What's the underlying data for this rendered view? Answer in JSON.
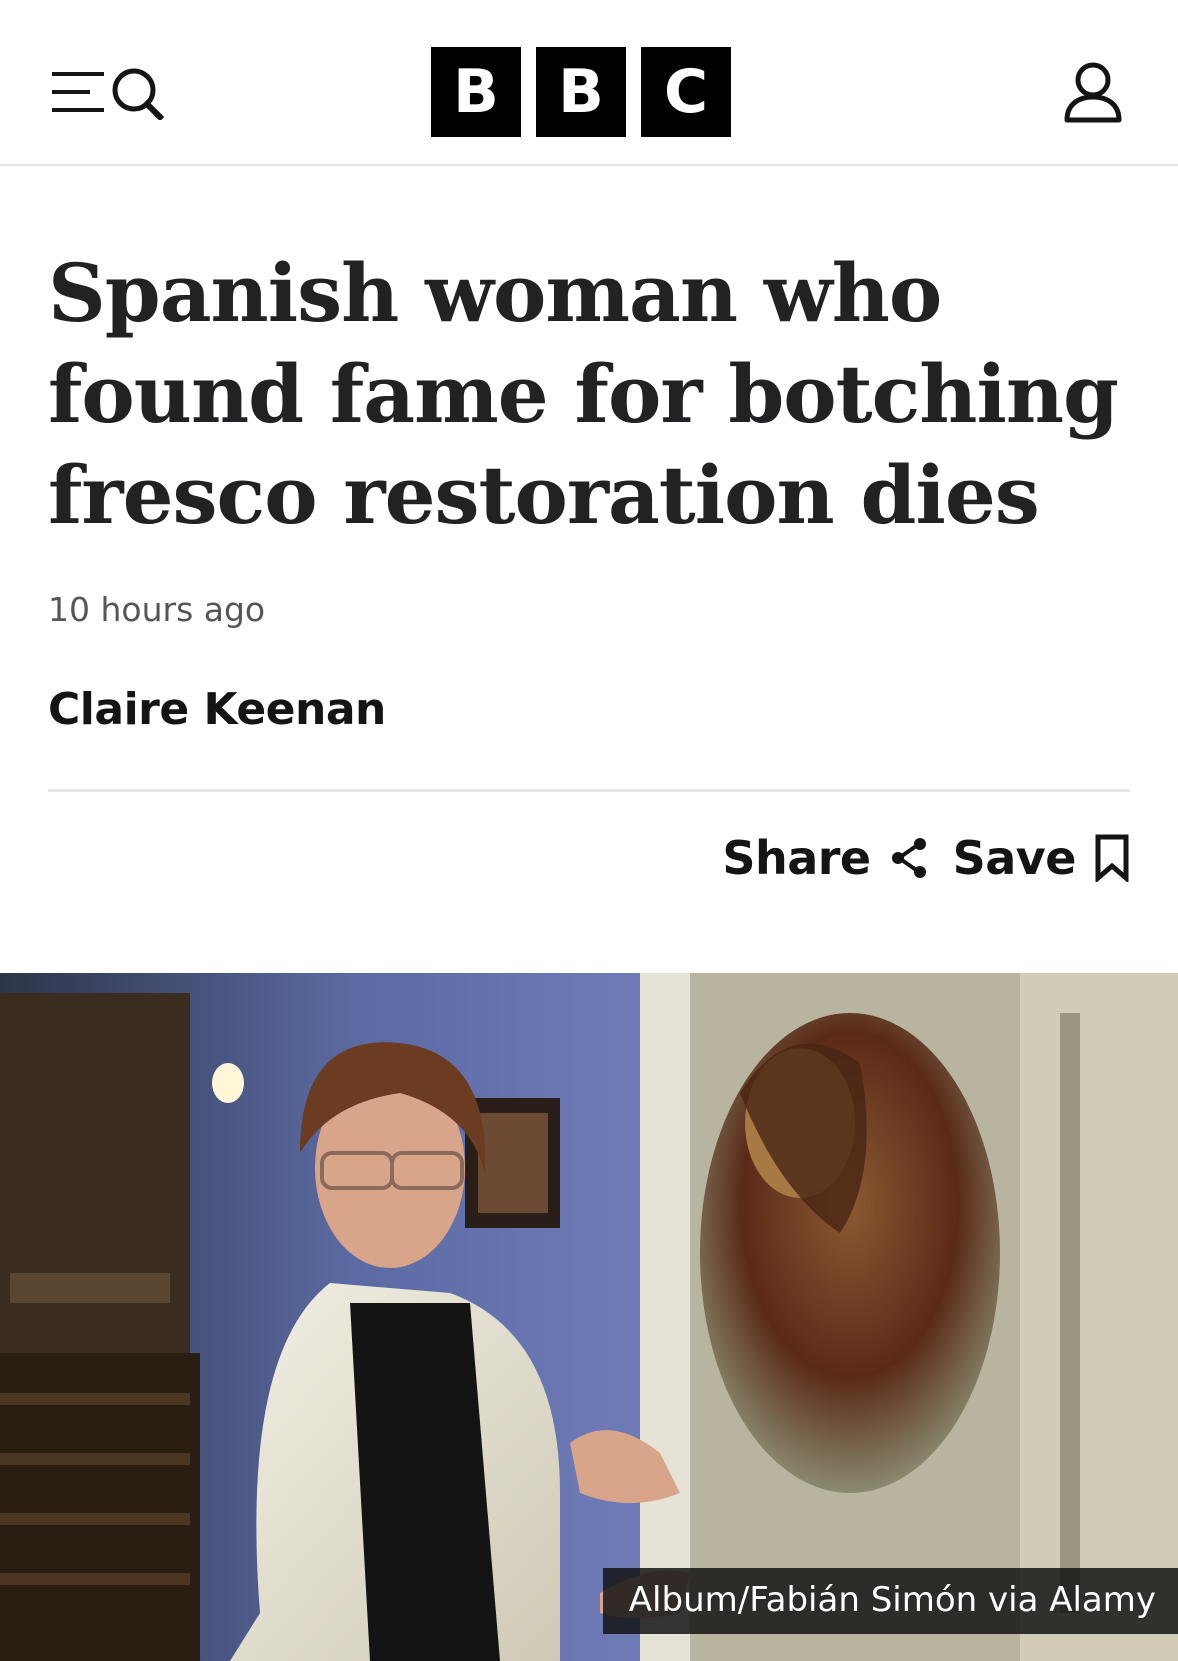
{
  "header": {
    "logo_letters": [
      "B",
      "B",
      "C"
    ]
  },
  "article": {
    "headline": "Spanish woman who found fame for botching fresco restoration dies",
    "timestamp": "10 hours ago",
    "author": "Claire Keenan",
    "actions": {
      "share_label": "Share",
      "save_label": "Save"
    },
    "image": {
      "caption": "Album/Fabián Simón via Alamy"
    }
  },
  "icons": {
    "menu": "menu-icon",
    "search": "search-icon",
    "account": "account-icon",
    "share": "share-icon",
    "save": "bookmark-icon"
  }
}
